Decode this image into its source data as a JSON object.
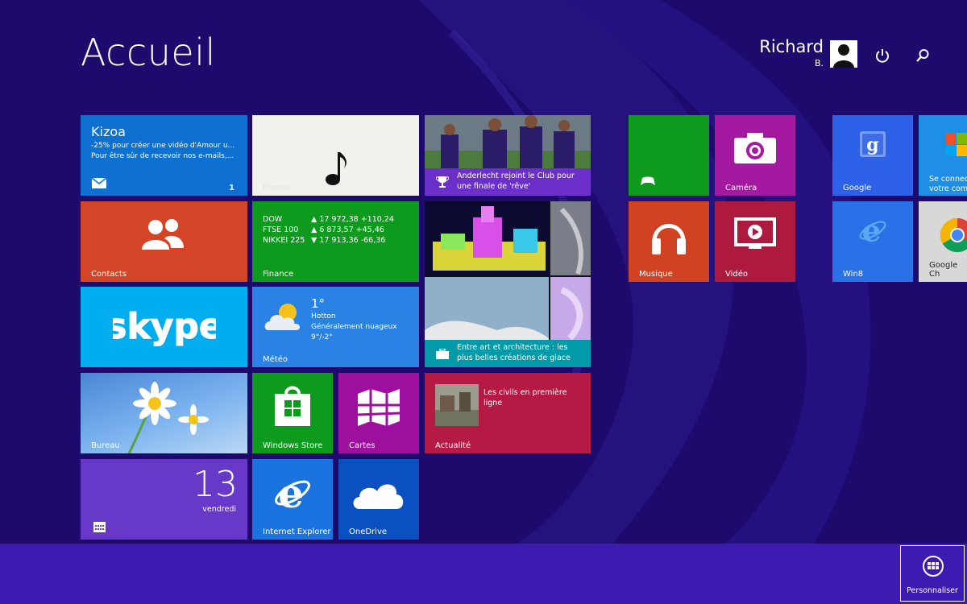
{
  "header": {
    "title": "Accueil",
    "user_name": "Richard",
    "user_sub": "B.",
    "power_icon": "power-icon",
    "search_icon": "search-icon"
  },
  "tiles": {
    "kizoa": {
      "title": "Kizoa",
      "line1": "-25% pour créer une vidéo d'Amour u...",
      "line2": "Pour être sûr de recevoir nos e-mails,...",
      "badge": "1",
      "icon": "mail-icon",
      "color": "#0e71d1"
    },
    "photos": {
      "label": "Photos",
      "icon": "music-note-icon"
    },
    "sport": {
      "caption": "Anderlecht rejoint le Club pour une finale de 'rêve'",
      "icon": "trophy-icon",
      "color": "#6a30c9"
    },
    "contacts": {
      "label": "Contacts",
      "icon": "people-icon",
      "color": "#d44527"
    },
    "finance": {
      "label": "Finance",
      "color": "#0d9a1d",
      "rows": [
        {
          "name": "DOW",
          "value": "▲ 17 972,38 +110,24"
        },
        {
          "name": "FTSE 100",
          "value": "▲ 6 873,57 +45,46"
        },
        {
          "name": "NIKKEI 225",
          "value": "▼ 17 913,36 -66,36"
        }
      ]
    },
    "travel": {
      "caption": "Entre art et architecture : les plus belles créations de glace",
      "icon": "suitcase-icon",
      "color": "#009aa8"
    },
    "skype": {
      "logo": "skype",
      "color": "#00aeef"
    },
    "meteo": {
      "label": "Météo",
      "temp": "1°",
      "city": "Hotton",
      "desc": "Généralement nuageux",
      "range": "9°/-2°",
      "icon": "cloud-sun-icon",
      "color": "#2a82e4"
    },
    "bureau": {
      "label": "Bureau"
    },
    "store": {
      "label": "Windows Store",
      "icon": "store-bag-icon",
      "color": "#0d9a1d"
    },
    "cartes": {
      "label": "Cartes",
      "icon": "map-icon",
      "color": "#9c0f9f"
    },
    "actualite": {
      "label": "Actualité",
      "headline": "Les civils en première ligne",
      "color": "#b41a43"
    },
    "calendar": {
      "day": "13",
      "weekday": "vendredi",
      "icon": "calendar-icon",
      "color": "#6838c8"
    },
    "ie": {
      "label": "Internet Explorer",
      "icon": "ie-icon",
      "color": "#1b73e0"
    },
    "onedrive": {
      "label": "OneDrive",
      "icon": "cloud-icon",
      "color": "#0a50c1"
    },
    "xbox": {
      "label": "",
      "icon": "gamepad-icon",
      "color": "#0d9a1d"
    },
    "camera": {
      "label": "Caméra",
      "icon": "camera-icon",
      "color": "#a3199f"
    },
    "musique": {
      "label": "Musique",
      "icon": "headphones-icon",
      "color": "#d14222"
    },
    "video": {
      "label": "Vidéo",
      "icon": "play-screen-icon",
      "color": "#ae1a3e"
    },
    "google": {
      "label": "Google",
      "icon": "google-icon",
      "color": "#2d62e8"
    },
    "windows_tile": {
      "label": "Se connect votre comp",
      "line1": "Se connect",
      "line2": "votre comp",
      "color": "#1e8ee6"
    },
    "win8": {
      "label": "Win8",
      "icon": "ie-icon",
      "color": "#2a70e6"
    },
    "chrome": {
      "label": "Google Ch",
      "icon": "chrome-icon",
      "color": "#d8d8d8"
    }
  },
  "appbar": {
    "personalize_label": "Personnaliser",
    "icon": "grid-icon",
    "color": "#3c1cb0"
  }
}
